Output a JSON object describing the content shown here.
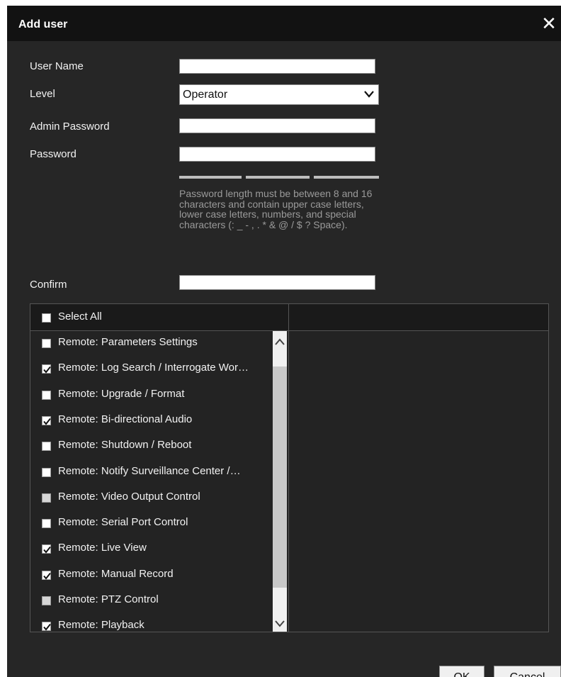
{
  "dialog": {
    "title": "Add user",
    "close_icon": "close-icon"
  },
  "form": {
    "user_name_label": "User Name",
    "user_name_value": "",
    "level_label": "Level",
    "level_value": "Operator",
    "admin_password_label": "Admin Password",
    "admin_password_value": "",
    "password_label": "Password",
    "password_value": "",
    "password_hint": "Password length must be between 8 and 16 characters and contain upper case letters, lower case letters, numbers, and special characters (: _ - , . * & @ / $ ? Space).",
    "confirm_label": "Confirm",
    "confirm_value": ""
  },
  "permissions": {
    "select_all_label": "Select All",
    "select_all_checked": false,
    "items": [
      {
        "label": "Remote: Parameters Settings",
        "checked": false,
        "enabled": true
      },
      {
        "label": "Remote: Log Search / Interrogate Wor…",
        "checked": true,
        "enabled": true
      },
      {
        "label": "Remote: Upgrade / Format",
        "checked": false,
        "enabled": true
      },
      {
        "label": "Remote: Bi-directional Audio",
        "checked": true,
        "enabled": true
      },
      {
        "label": "Remote: Shutdown / Reboot",
        "checked": false,
        "enabled": true
      },
      {
        "label": "Remote: Notify Surveillance Center /…",
        "checked": false,
        "enabled": true
      },
      {
        "label": "Remote: Video Output Control",
        "checked": false,
        "enabled": false
      },
      {
        "label": "Remote: Serial Port Control",
        "checked": false,
        "enabled": true
      },
      {
        "label": "Remote: Live View",
        "checked": true,
        "enabled": true
      },
      {
        "label": "Remote: Manual Record",
        "checked": true,
        "enabled": true
      },
      {
        "label": "Remote: PTZ Control",
        "checked": false,
        "enabled": false
      },
      {
        "label": "Remote: Playback",
        "checked": true,
        "enabled": true
      }
    ]
  },
  "buttons": {
    "ok_label": "OK",
    "cancel_label": "Cancel"
  },
  "colors": {
    "dialog_bg": "#262626",
    "titlebar_bg": "#121212",
    "text": "#f2f2f2",
    "hint_text": "#9a9a9a"
  }
}
